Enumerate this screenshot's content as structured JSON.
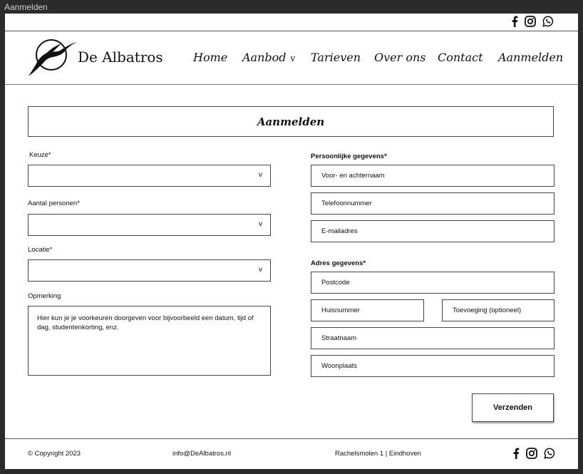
{
  "window": {
    "title": "Aanmelden"
  },
  "header": {
    "brand": "De Albatros",
    "nav": [
      {
        "label": "Home"
      },
      {
        "label": "Aanbod",
        "chevron": "v"
      },
      {
        "label": "Tarieven"
      },
      {
        "label": "Over ons"
      },
      {
        "label": "Contact"
      },
      {
        "label": "Aanmelden"
      }
    ],
    "social_icons": [
      "facebook-icon",
      "instagram-icon",
      "whatsapp-icon"
    ]
  },
  "form": {
    "title": "Aanmelden",
    "left": {
      "keuze_label": "Keuze*",
      "personen_label": "Aantal personen*",
      "locatie_label": "Locatie*",
      "dropdown_arrow": "v",
      "opmerking_label": "Opmerking",
      "opmerking_placeholder": "Hier kun je je voorkeuren doorgeven voor bijvoorbeeld een datum, tijd of dag, studentenkorting, enz."
    },
    "right": {
      "persoonlijk_label": "Persoonlijke gegevens*",
      "naam": "Voor- en achternaam",
      "telefoon": "Telefoonnummer",
      "email": "E-mailadres",
      "adres_label": "Adres gegevens*",
      "postcode": "Postcode",
      "huisnummer": "Huisnummer",
      "toevoeging": "Toevoeging (optioneel)",
      "straatnaam": "Straatnaam",
      "woonplaats": "Woonplaats"
    },
    "submit_label": "Verzenden"
  },
  "footer": {
    "copyright": "© Copyright 2023",
    "email": "info@DeAlbatros.nl",
    "address": "Rachelsmolen 1 | Eindhoven"
  }
}
